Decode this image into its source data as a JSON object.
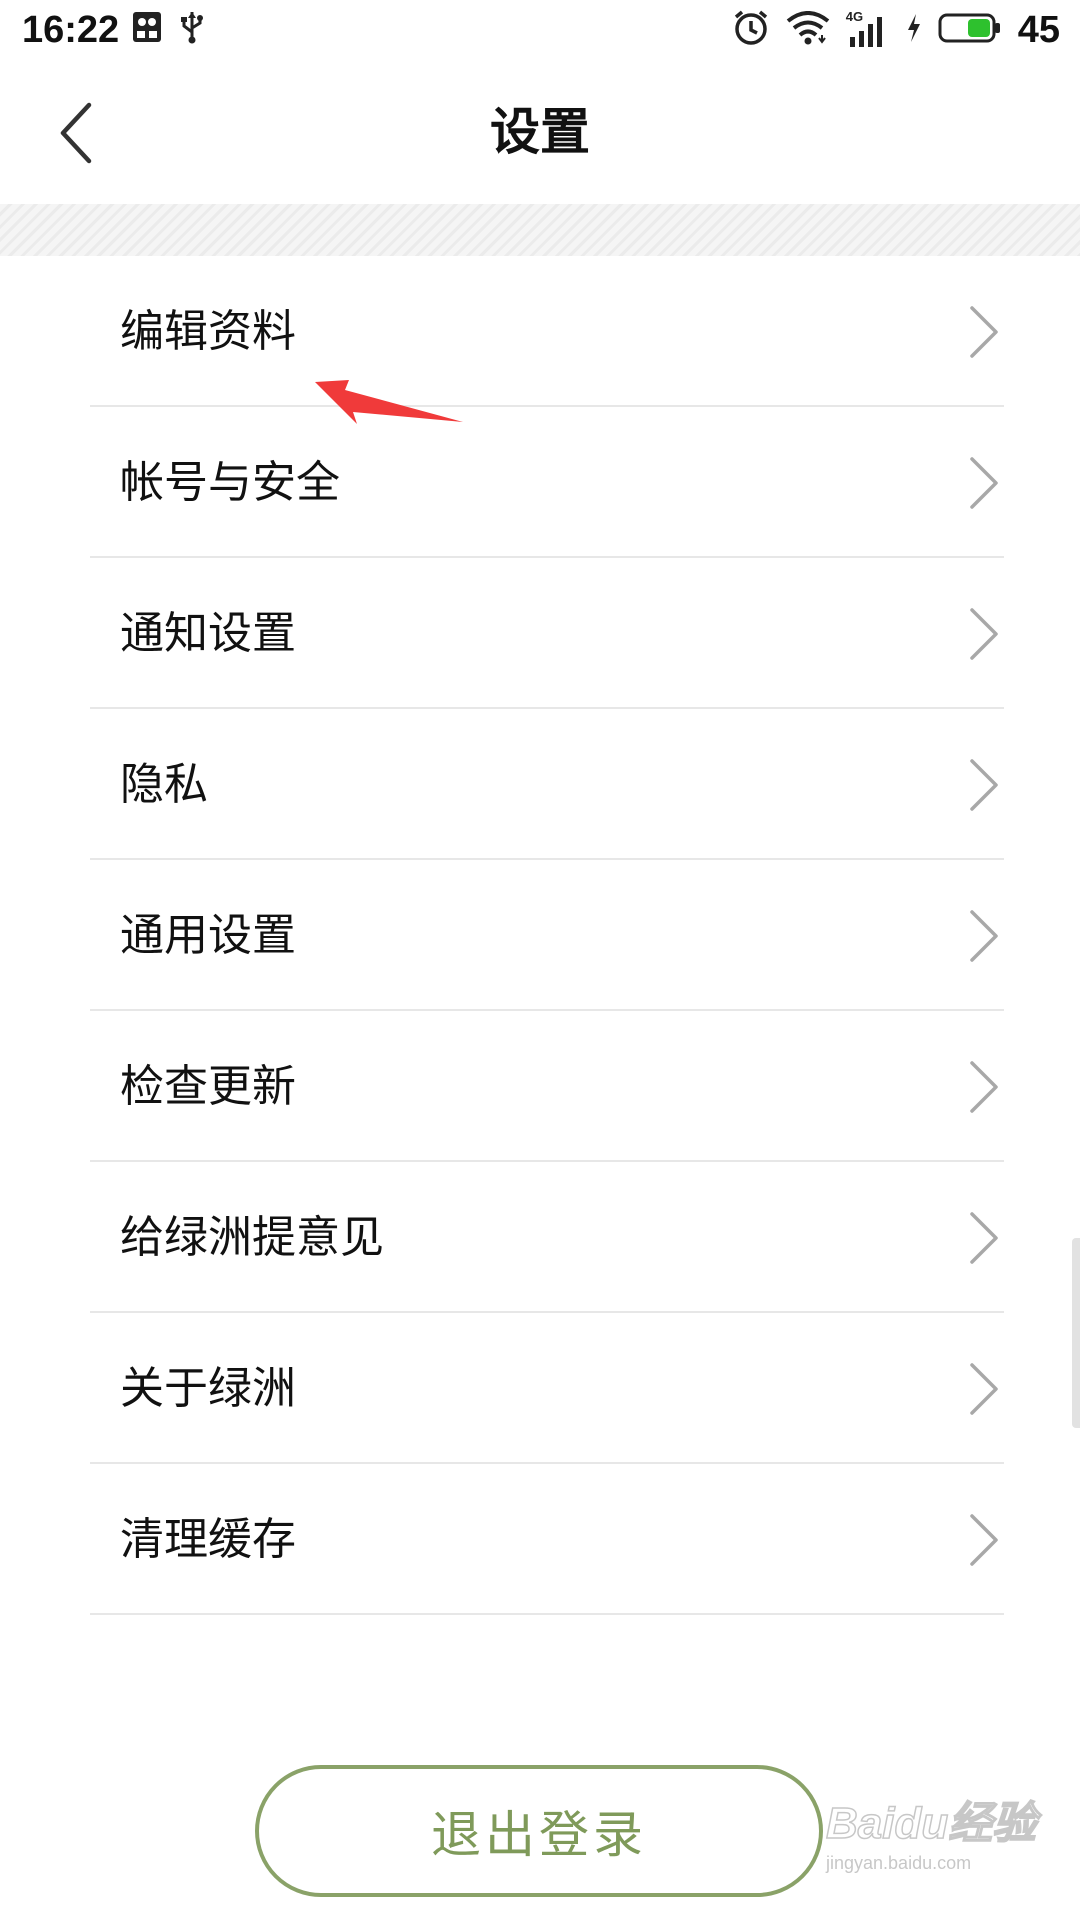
{
  "status_bar": {
    "time": "16:22",
    "network_label": "4G",
    "battery_level": "45",
    "battery_color": "#2ec12e"
  },
  "header": {
    "title": "设置",
    "back_icon": "chevron-left-icon"
  },
  "menu": {
    "items": [
      {
        "label": "编辑资料"
      },
      {
        "label": "帐号与安全"
      },
      {
        "label": "通知设置"
      },
      {
        "label": "隐私"
      },
      {
        "label": "通用设置"
      },
      {
        "label": "检查更新"
      },
      {
        "label": "给绿洲提意见"
      },
      {
        "label": "关于绿洲"
      },
      {
        "label": "清理缓存"
      }
    ],
    "chevron_icon": "chevron-right-icon"
  },
  "logout": {
    "label": "退出登录",
    "accent_color": "#8aa268"
  },
  "annotation": {
    "arrow_color": "#f03a3a"
  },
  "watermark": {
    "logo": "Baidu经验",
    "url": "jingyan.baidu.com"
  }
}
